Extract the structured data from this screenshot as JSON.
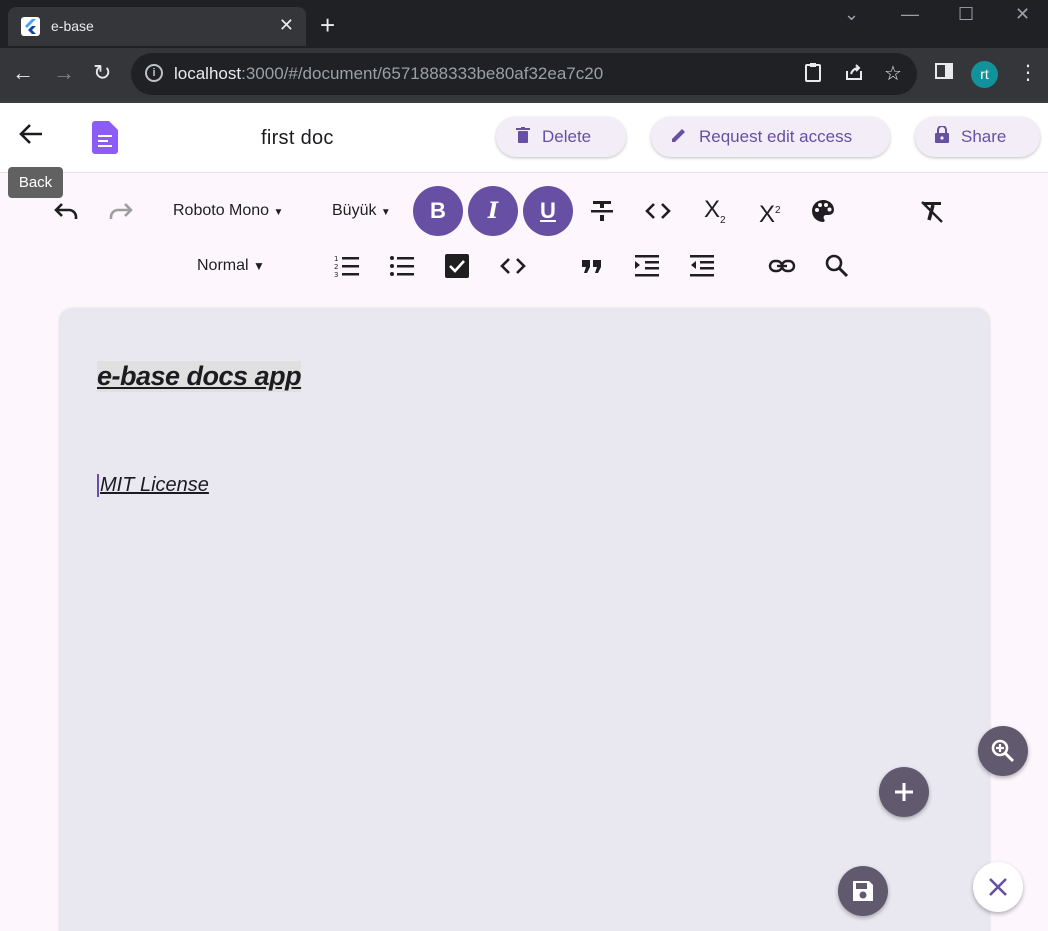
{
  "browser": {
    "tab_title": "e-base",
    "tab_close": "✕",
    "new_tab": "+",
    "url_host": "localhost",
    "url_path": ":3000/#/document/6571888333be80af32ea7c20",
    "avatar_initials": "rt"
  },
  "header": {
    "title": "first doc",
    "back_tooltip": "Back",
    "delete_label": "Delete",
    "request_edit_label": "Request edit access",
    "share_label": "Share"
  },
  "toolbar": {
    "font_family": "Roboto Mono",
    "font_size": "Büyük",
    "heading_style": "Normal",
    "bold": "B",
    "italic": "I",
    "underline": "U"
  },
  "document": {
    "heading": "e-base docs app",
    "body": "MIT License"
  },
  "colors": {
    "accent": "#6750a4",
    "doc_icon": "#8b5cf6",
    "fab": "#615a6e",
    "avatar": "#12929b"
  },
  "icons": [
    "undo-icon",
    "redo-icon",
    "strikethrough-icon",
    "code-icon",
    "subscript-icon",
    "superscript-icon",
    "palette-icon",
    "clear-format-icon",
    "numbered-list-icon",
    "bullet-list-icon",
    "checkbox-icon",
    "code-block-icon",
    "quote-icon",
    "indent-icon",
    "outdent-icon",
    "link-icon",
    "search-icon",
    "zoom-in-icon",
    "add-icon",
    "save-icon",
    "close-icon"
  ]
}
